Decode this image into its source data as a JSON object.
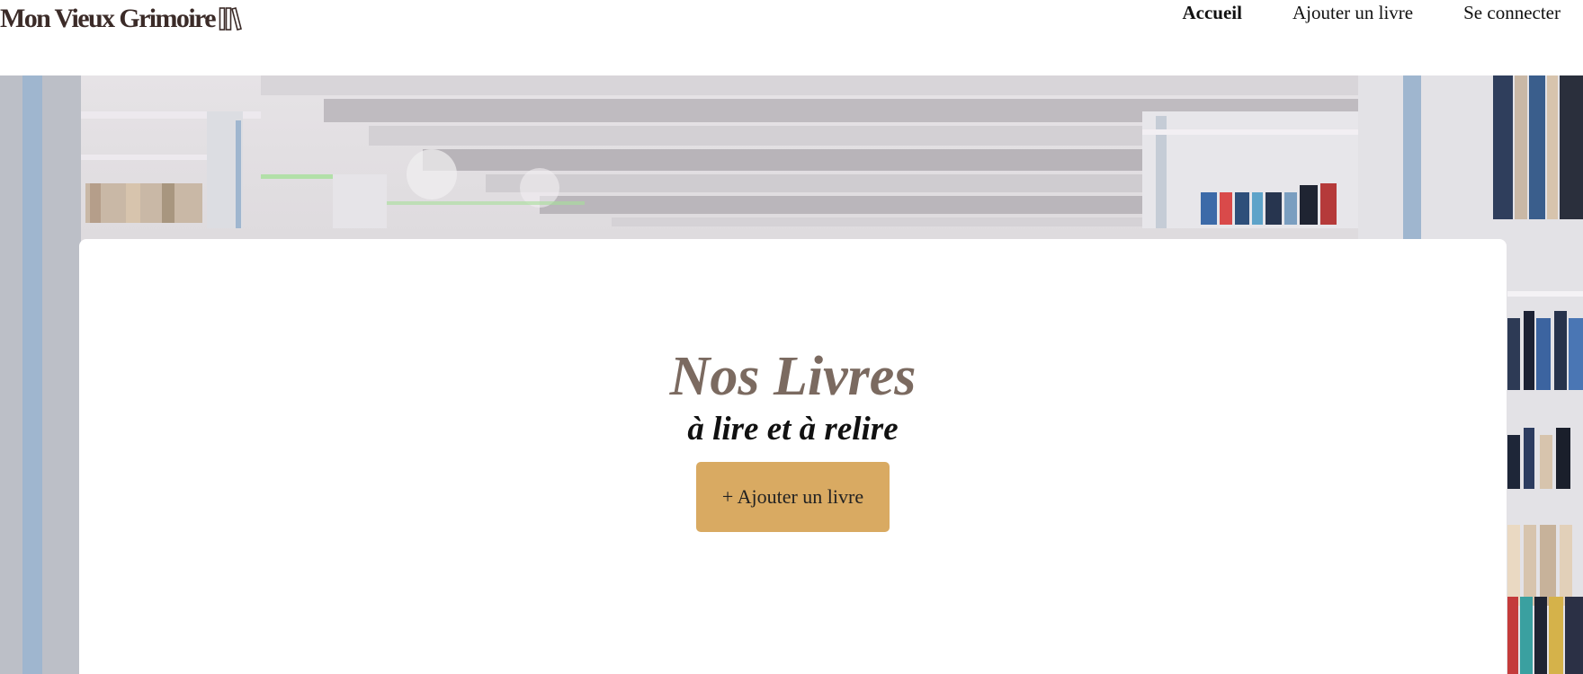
{
  "header": {
    "logo_text": "Mon Vieux Grimoire",
    "logo_icon": "books-icon"
  },
  "nav": {
    "items": [
      {
        "label": "Accueil",
        "active": true
      },
      {
        "label": "Ajouter un livre",
        "active": false
      },
      {
        "label": "Se connecter",
        "active": false
      }
    ]
  },
  "hero": {
    "title": "Nos Livres",
    "subtitle": "à lire et à relire",
    "add_button_label": "+ Ajouter un livre"
  },
  "colors": {
    "brand_text": "#3b2b28",
    "title": "#7b6a60",
    "button": "#d9aa62"
  }
}
